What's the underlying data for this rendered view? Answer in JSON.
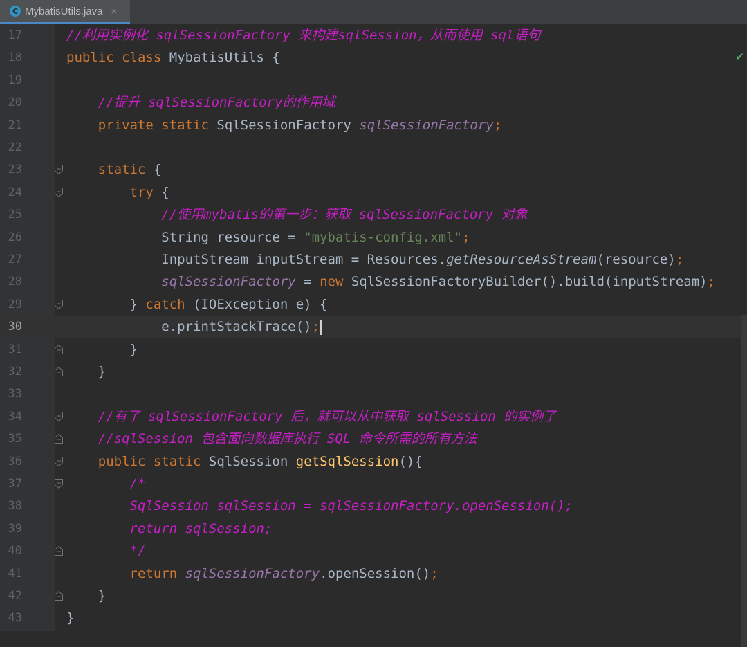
{
  "tab": {
    "icon": "C",
    "filename": "MybatisUtils.java",
    "close": "×"
  },
  "lines": [
    {
      "num": "17",
      "fold": "",
      "parts": [
        {
          "t": "//利用实例化 sqlSessionFactory 来构建sqlSession，从而使用 sql语句",
          "c": "cm"
        }
      ]
    },
    {
      "num": "18",
      "fold": "",
      "parts": [
        {
          "t": "public class ",
          "c": "kw"
        },
        {
          "t": "MybatisUtils {",
          "c": ""
        }
      ]
    },
    {
      "num": "19",
      "fold": "",
      "parts": []
    },
    {
      "num": "20",
      "fold": "",
      "parts": [
        {
          "t": "    ",
          "c": ""
        },
        {
          "t": "//提升 sqlSessionFactory的作用域",
          "c": "cm"
        }
      ]
    },
    {
      "num": "21",
      "fold": "",
      "parts": [
        {
          "t": "    ",
          "c": ""
        },
        {
          "t": "private static ",
          "c": "kw"
        },
        {
          "t": "SqlSessionFactory ",
          "c": ""
        },
        {
          "t": "sqlSessionFactory",
          "c": "fld"
        },
        {
          "t": ";",
          "c": "kw"
        }
      ]
    },
    {
      "num": "22",
      "fold": "",
      "parts": []
    },
    {
      "num": "23",
      "fold": "open",
      "parts": [
        {
          "t": "    ",
          "c": ""
        },
        {
          "t": "static ",
          "c": "kw"
        },
        {
          "t": "{",
          "c": ""
        }
      ]
    },
    {
      "num": "24",
      "fold": "open",
      "parts": [
        {
          "t": "        ",
          "c": ""
        },
        {
          "t": "try ",
          "c": "kw"
        },
        {
          "t": "{",
          "c": ""
        }
      ]
    },
    {
      "num": "25",
      "fold": "",
      "parts": [
        {
          "t": "            ",
          "c": ""
        },
        {
          "t": "//使用mybatis的第一步：获取 sqlSessionFactory 对象",
          "c": "cm"
        }
      ]
    },
    {
      "num": "26",
      "fold": "",
      "parts": [
        {
          "t": "            String resource = ",
          "c": ""
        },
        {
          "t": "\"mybatis-config.xml\"",
          "c": "st"
        },
        {
          "t": ";",
          "c": "kw"
        }
      ]
    },
    {
      "num": "27",
      "fold": "",
      "parts": [
        {
          "t": "            InputStream inputStream = Resources.",
          "c": ""
        },
        {
          "t": "getResourceAsStream",
          "c": "smi"
        },
        {
          "t": "(resource)",
          "c": ""
        },
        {
          "t": ";",
          "c": "kw"
        }
      ]
    },
    {
      "num": "28",
      "fold": "",
      "parts": [
        {
          "t": "            ",
          "c": ""
        },
        {
          "t": "sqlSessionFactory",
          "c": "fld"
        },
        {
          "t": " = ",
          "c": ""
        },
        {
          "t": "new ",
          "c": "kw"
        },
        {
          "t": "SqlSessionFactoryBuilder().build(inputStream)",
          "c": ""
        },
        {
          "t": ";",
          "c": "kw"
        }
      ]
    },
    {
      "num": "29",
      "fold": "open",
      "parts": [
        {
          "t": "        } ",
          "c": ""
        },
        {
          "t": "catch ",
          "c": "kw"
        },
        {
          "t": "(IOException e) {",
          "c": ""
        }
      ]
    },
    {
      "num": "30",
      "fold": "",
      "current": true,
      "parts": [
        {
          "t": "            e.printStackTrace()",
          "c": ""
        },
        {
          "t": ";",
          "c": "kw"
        }
      ]
    },
    {
      "num": "31",
      "fold": "close",
      "parts": [
        {
          "t": "        }",
          "c": ""
        }
      ]
    },
    {
      "num": "32",
      "fold": "close",
      "parts": [
        {
          "t": "    }",
          "c": ""
        }
      ]
    },
    {
      "num": "33",
      "fold": "",
      "parts": []
    },
    {
      "num": "34",
      "fold": "open",
      "parts": [
        {
          "t": "    ",
          "c": ""
        },
        {
          "t": "//有了 sqlSessionFactory 后，就可以从中获取 sqlSession 的实例了",
          "c": "cm"
        }
      ]
    },
    {
      "num": "35",
      "fold": "close",
      "parts": [
        {
          "t": "    ",
          "c": ""
        },
        {
          "t": "//sqlSession 包含面向数据库执行 SQL 命令所需的所有方法",
          "c": "cm"
        }
      ]
    },
    {
      "num": "36",
      "fold": "open",
      "parts": [
        {
          "t": "    ",
          "c": ""
        },
        {
          "t": "public static ",
          "c": "kw"
        },
        {
          "t": "SqlSession ",
          "c": ""
        },
        {
          "t": "getSqlSession",
          "c": "mt"
        },
        {
          "t": "(){",
          "c": ""
        }
      ]
    },
    {
      "num": "37",
      "fold": "open",
      "parts": [
        {
          "t": "        ",
          "c": ""
        },
        {
          "t": "/*",
          "c": "cm"
        }
      ]
    },
    {
      "num": "38",
      "fold": "",
      "parts": [
        {
          "t": "        ",
          "c": ""
        },
        {
          "t": "SqlSession sqlSession = sqlSessionFactory.openSession();",
          "c": "cm"
        }
      ]
    },
    {
      "num": "39",
      "fold": "",
      "parts": [
        {
          "t": "        ",
          "c": ""
        },
        {
          "t": "return sqlSession;",
          "c": "cm"
        }
      ]
    },
    {
      "num": "40",
      "fold": "close",
      "parts": [
        {
          "t": "        ",
          "c": ""
        },
        {
          "t": "*/",
          "c": "cm"
        }
      ]
    },
    {
      "num": "41",
      "fold": "",
      "parts": [
        {
          "t": "        ",
          "c": ""
        },
        {
          "t": "return ",
          "c": "kw"
        },
        {
          "t": "sqlSessionFactory",
          "c": "fld"
        },
        {
          "t": ".openSession()",
          "c": ""
        },
        {
          "t": ";",
          "c": "kw"
        }
      ]
    },
    {
      "num": "42",
      "fold": "close",
      "parts": [
        {
          "t": "    }",
          "c": ""
        }
      ]
    },
    {
      "num": "43",
      "fold": "",
      "parts": [
        {
          "t": "}",
          "c": ""
        }
      ]
    }
  ]
}
